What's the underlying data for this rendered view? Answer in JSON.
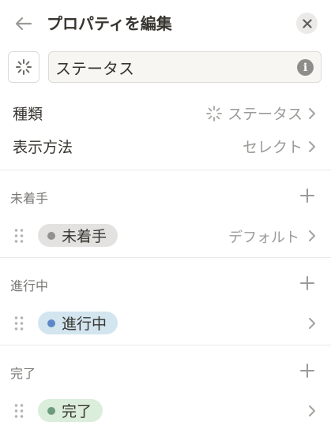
{
  "header": {
    "title": "プロパティを編集",
    "back_icon": "arrow-left-icon",
    "close_icon": "close-icon"
  },
  "property": {
    "icon": "status-spinner-icon",
    "name_value": "ステータス",
    "info_icon_glyph": "i"
  },
  "settings": [
    {
      "label": "種類",
      "value": "ステータス",
      "value_icon": "status-spinner-icon"
    },
    {
      "label": "表示方法",
      "value": "セレクト"
    }
  ],
  "groups": [
    {
      "title": "未着手",
      "options": [
        {
          "label": "未着手",
          "badge": "デフォルト",
          "pill_bg": "#e3e2e0",
          "dot": "#91918e"
        }
      ]
    },
    {
      "title": "進行中",
      "options": [
        {
          "label": "進行中",
          "badge": "",
          "pill_bg": "#d3e5ef",
          "dot": "#5e87c9"
        }
      ]
    },
    {
      "title": "完了",
      "options": [
        {
          "label": "完了",
          "badge": "",
          "pill_bg": "#dbeddb",
          "dot": "#6c9b7d"
        }
      ]
    }
  ],
  "colors": {
    "text_primary": "#37352f",
    "text_secondary": "#9b9a97",
    "divider": "#e9e9e7"
  }
}
